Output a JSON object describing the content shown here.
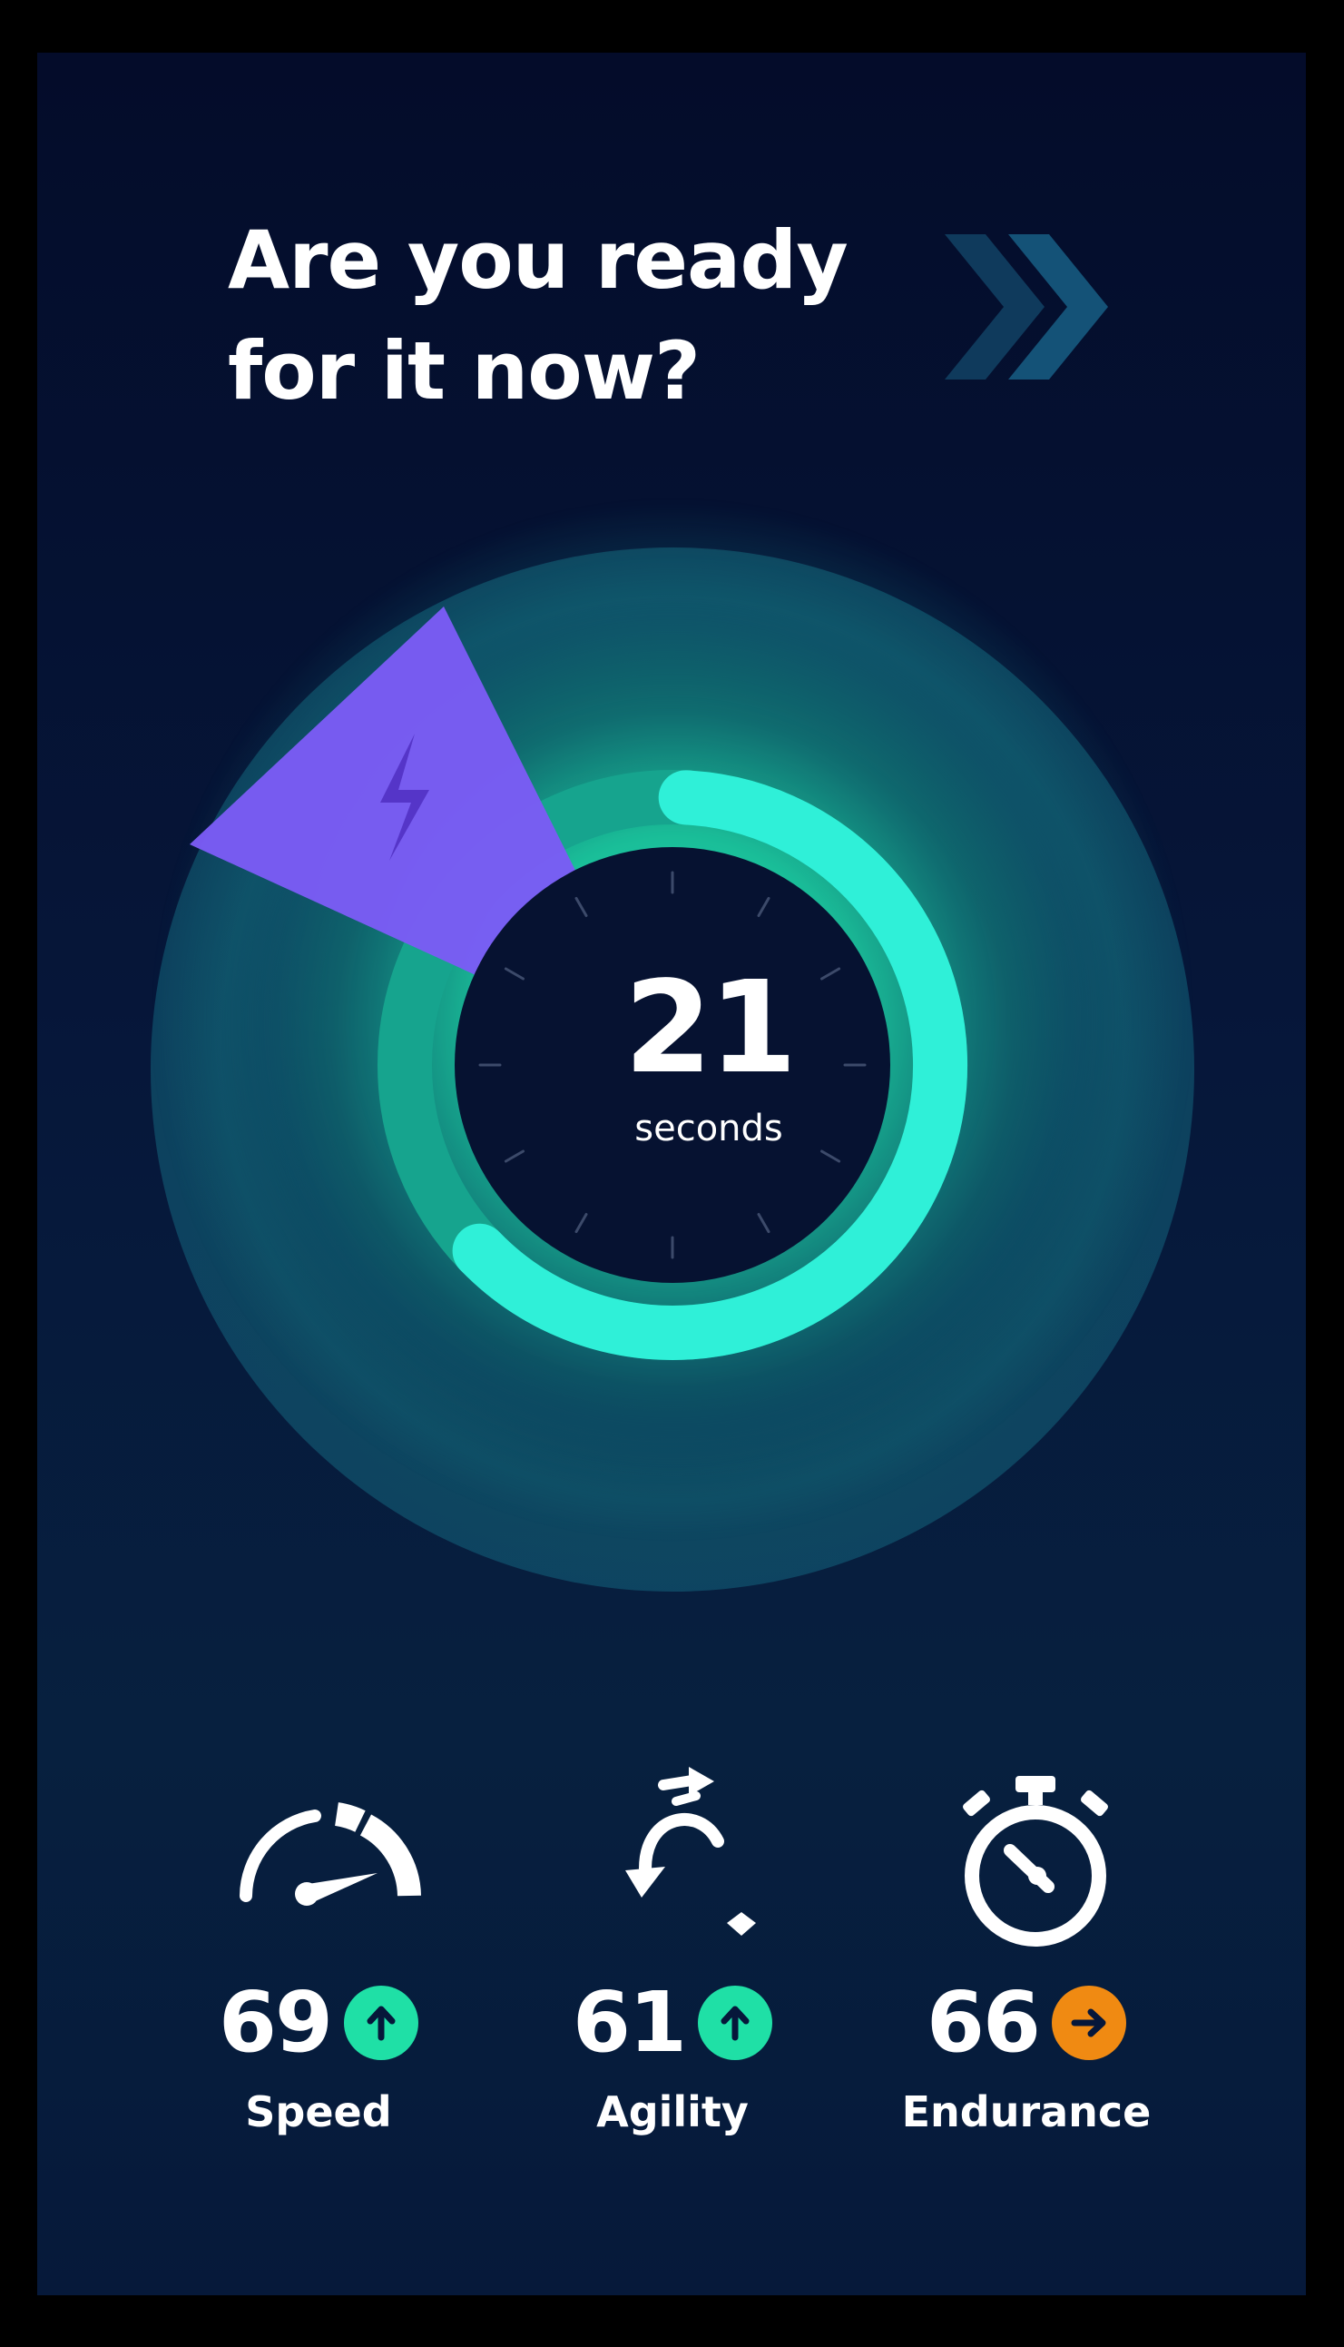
{
  "headline": {
    "line1": "Are you ready",
    "line2": "for it now?"
  },
  "next_button": {
    "icon": "double-chevron-right-icon"
  },
  "timer": {
    "value": "21",
    "unit": "seconds",
    "progress_fraction": 0.62,
    "boost_icon": "lightning-bolt-icon"
  },
  "stats": [
    {
      "value": "69",
      "label": "Speed",
      "icon": "speedometer-icon",
      "trend": "up",
      "trend_icon": "arrow-up-icon",
      "trend_color": "#1fe0a6"
    },
    {
      "value": "61",
      "label": "Agility",
      "icon": "agility-arrows-icon",
      "trend": "up",
      "trend_icon": "arrow-up-icon",
      "trend_color": "#1fe0a6"
    },
    {
      "value": "66",
      "label": "Endurance",
      "icon": "stopwatch-icon",
      "trend": "flat",
      "trend_icon": "arrow-right-icon",
      "trend_color": "#f08a12"
    }
  ],
  "colors": {
    "background": "#06173a",
    "accent_teal": "#1fe0c8",
    "accent_green": "#1fe0a6",
    "accent_purple": "#7b5cf5",
    "accent_orange": "#f08a12",
    "text": "#ffffff"
  }
}
